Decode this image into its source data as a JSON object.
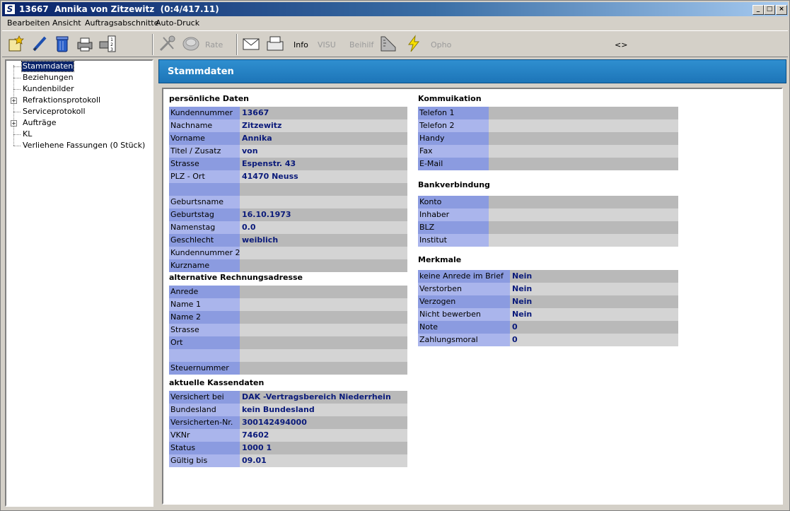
{
  "window": {
    "title": "13667  Annika von Zitzewitz  (0:4/417.11)",
    "app_icon": "S",
    "buttons": {
      "minimize": "_",
      "maximize": "□",
      "close": "×"
    }
  },
  "menu": [
    "Bearbeiten",
    "Ansicht",
    "Auftragsabschnitte",
    "Auto-Druck"
  ],
  "toolbar": {
    "rate": "Rate",
    "info": "Info",
    "visu": "VISU",
    "beihilf": "Beihilf",
    "opho": "Opho",
    "nav": "<>"
  },
  "tree": [
    "Stammdaten",
    "Beziehungen",
    "Kundenbilder",
    "Refraktionsprotokoll",
    "Serviceprotokoll",
    "Aufträge",
    "KL",
    "Verliehene Fassungen (0 Stück)"
  ],
  "page_title": "Stammdaten",
  "personal": {
    "title": "persönliche Daten",
    "rows": [
      {
        "label": "Kundennummer",
        "value": "13667"
      },
      {
        "label": "Nachname",
        "value": "Zitzewitz"
      },
      {
        "label": "Vorname",
        "value": "Annika"
      },
      {
        "label": "Titel / Zusatz",
        "value": "von"
      },
      {
        "label": "Strasse",
        "value": "Espenstr. 43"
      },
      {
        "label": "PLZ - Ort",
        "value": "41470 Neuss"
      },
      {
        "label": "",
        "value": ""
      },
      {
        "label": "Geburtsname",
        "value": ""
      },
      {
        "label": "Geburtstag",
        "value": "16.10.1973"
      },
      {
        "label": "Namenstag",
        "value": "0.0"
      },
      {
        "label": "Geschlecht",
        "value": "weiblich"
      },
      {
        "label": "Kundennummer 2",
        "value": ""
      },
      {
        "label": "Kurzname",
        "value": ""
      }
    ]
  },
  "billing": {
    "title": "alternative Rechnungsadresse",
    "rows": [
      {
        "label": "Anrede",
        "value": ""
      },
      {
        "label": "Name 1",
        "value": ""
      },
      {
        "label": "Name 2",
        "value": ""
      },
      {
        "label": "Strasse",
        "value": ""
      },
      {
        "label": "Ort",
        "value": ""
      },
      {
        "label": "",
        "value": ""
      },
      {
        "label": "Steuernummer",
        "value": ""
      }
    ]
  },
  "insurance": {
    "title": "aktuelle Kassendaten",
    "rows": [
      {
        "label": "Versichert bei",
        "value": "DAK -Vertragsbereich Niederrhein"
      },
      {
        "label": "Bundesland",
        "value": "kein Bundesland"
      },
      {
        "label": "Versicherten-Nr.",
        "value": "300142494000"
      },
      {
        "label": "VKNr",
        "value": "74602"
      },
      {
        "label": "Status",
        "value": "1000 1"
      },
      {
        "label": "Gültig bis",
        "value": "09.01"
      }
    ]
  },
  "communication": {
    "title": "Kommuikation",
    "rows": [
      {
        "label": "Telefon 1",
        "value": ""
      },
      {
        "label": "Telefon 2",
        "value": ""
      },
      {
        "label": "Handy",
        "value": ""
      },
      {
        "label": "Fax",
        "value": ""
      },
      {
        "label": "E-Mail",
        "value": ""
      }
    ]
  },
  "bank": {
    "title": "Bankverbindung",
    "rows": [
      {
        "label": "Konto",
        "value": ""
      },
      {
        "label": "Inhaber",
        "value": ""
      },
      {
        "label": "BLZ",
        "value": ""
      },
      {
        "label": "Institut",
        "value": ""
      }
    ]
  },
  "features": {
    "title": "Merkmale",
    "rows": [
      {
        "label": "keine Anrede im Brief",
        "value": "Nein"
      },
      {
        "label": "Verstorben",
        "value": "Nein"
      },
      {
        "label": "Verzogen",
        "value": "Nein"
      },
      {
        "label": "Nicht bewerben",
        "value": "Nein"
      },
      {
        "label": "Note",
        "value": "0"
      },
      {
        "label": "Zahlungsmoral",
        "value": "0"
      }
    ]
  },
  "colors": {
    "label_a": "#8b9be0",
    "label_b": "#aab5ec",
    "value_a": "#b9b9b9",
    "value_b": "#d4d4d4",
    "value_text": "#0a1a7a",
    "header": "#1d75b8"
  }
}
